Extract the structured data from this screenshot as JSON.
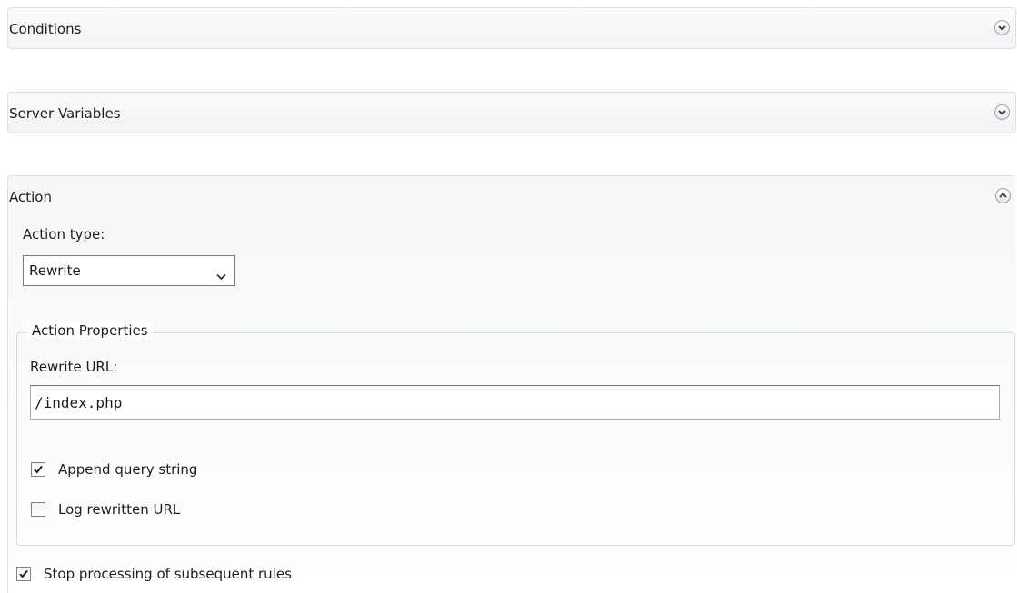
{
  "sections": {
    "conditions": {
      "title": "Conditions",
      "expanded": false,
      "chevron": "chevron-down-icon"
    },
    "server_variables": {
      "title": "Server Variables",
      "expanded": false,
      "chevron": "chevron-down-icon"
    },
    "action": {
      "title": "Action",
      "expanded": true,
      "chevron": "chevron-up-icon"
    }
  },
  "action": {
    "type_label": "Action type:",
    "type_value": "Rewrite",
    "properties_legend": "Action Properties",
    "rewrite_url_label": "Rewrite URL:",
    "rewrite_url_value": "/index.php",
    "append_query_label": "Append query string",
    "append_query_checked": true,
    "log_rewritten_label": "Log rewritten URL",
    "log_rewritten_checked": false,
    "stop_processing_label": "Stop processing of subsequent rules",
    "stop_processing_checked": true
  }
}
